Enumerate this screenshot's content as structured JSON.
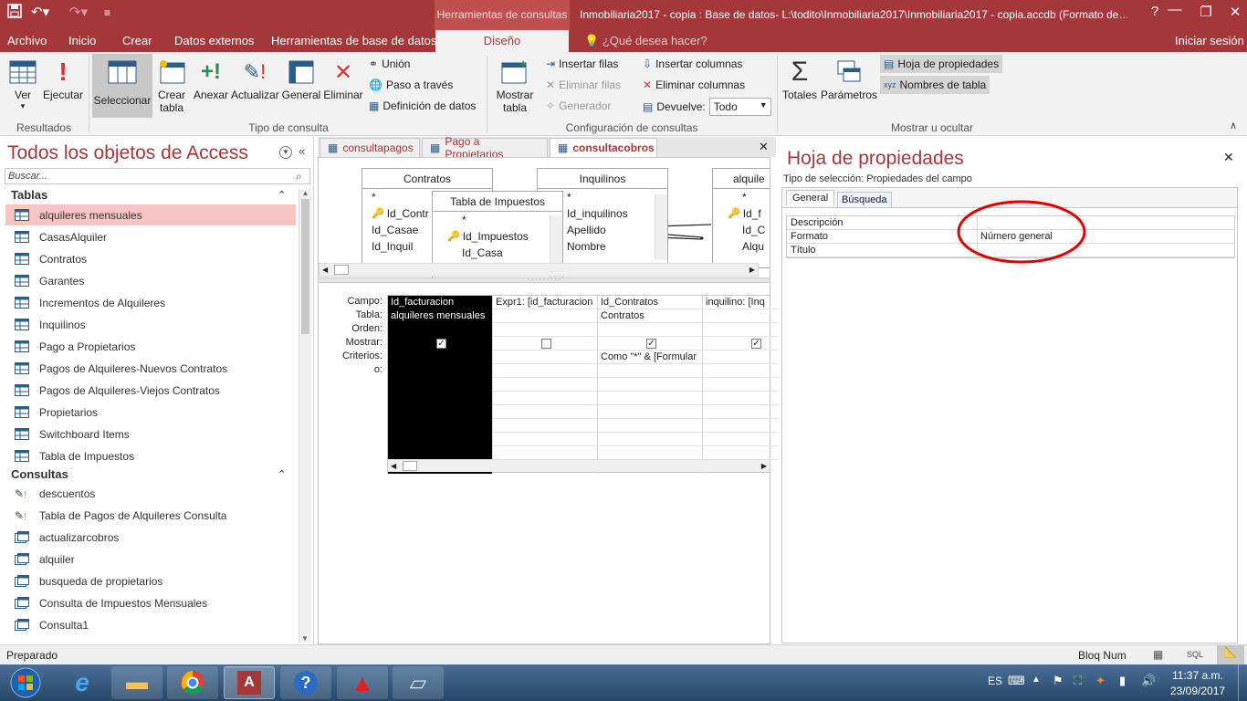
{
  "window": {
    "contextual_tab": "Herramientas de consultas",
    "title": "Inmobiliaria2017 - copia : Base de datos- L:\\todito\\Inmobiliaria2017\\Inmobiliaria2017 - copia.accdb (Formato de…",
    "help": "?",
    "minimize": "—",
    "restore": "❐",
    "close": "✕"
  },
  "menu": {
    "items": [
      "Archivo",
      "Inicio",
      "Crear",
      "Datos externos",
      "Herramientas de base de datos",
      "Diseño"
    ],
    "tell_me": "¿Qué desea hacer?",
    "signin": "Iniciar sesión"
  },
  "ribbon": {
    "ver": "Ver",
    "ejecutar": "Ejecutar",
    "group_resultados": "Resultados",
    "seleccionar": "Seleccionar",
    "crear_tabla_1": "Crear",
    "crear_tabla_2": "tabla",
    "anexar": "Anexar",
    "actualizar": "Actualizar",
    "general": "General",
    "eliminar": "Eliminar",
    "union": "Unión",
    "paso_a_traves": "Paso a través",
    "definicion_datos": "Definición de datos",
    "group_tipo": "Tipo de consulta",
    "mostrar_tabla_1": "Mostrar",
    "mostrar_tabla_2": "tabla",
    "insertar_filas": "Insertar filas",
    "eliminar_filas": "Eliminar filas",
    "generador": "Generador",
    "insertar_columnas": "Insertar columnas",
    "eliminar_columnas": "Eliminar columnas",
    "devuelve": "Devuelve:",
    "devuelve_value": "Todo",
    "group_config": "Configuración de consultas",
    "totales": "Totales",
    "parametros": "Parámetros",
    "hoja_propiedades": "Hoja de propiedades",
    "nombres_tabla": "Nombres de tabla",
    "group_mostrar": "Mostrar u ocultar"
  },
  "nav": {
    "title": "Todos los objetos de Access",
    "search_placeholder": "Buscar...",
    "section_tables": "Tablas",
    "tables": [
      "alquileres mensuales",
      "CasasAlquiler",
      "Contratos",
      "Garantes",
      "Incrementos de Alquileres",
      "Inquilinos",
      "Pago a Propietarios",
      "Pagos de Alquileres-Nuevos Contratos",
      "Pagos de Alquileres-Viejos Contratos",
      "Propietarios",
      "Switchboard Items",
      "Tabla de Impuestos"
    ],
    "section_queries": "Consultas",
    "queries": [
      "descuentos",
      "Tabla de Pagos de Alquileres Consulta",
      "actualizarcobros",
      "alquiler",
      "busqueda de propietarios",
      "Consulta de Impuestos Mensuales",
      "Consulta1"
    ]
  },
  "doc_tabs": [
    "consultapagos",
    "Pago a Propietarios",
    "consultacobros"
  ],
  "query": {
    "tables": {
      "contratos": {
        "title": "Contratos",
        "fields": [
          "*",
          "Id_Contr",
          "Id_Casae",
          "Id_Inquil"
        ]
      },
      "impuestos": {
        "title": "Tabla de Impuestos",
        "fields": [
          "*",
          "Id_Impuestos",
          "Id_Casa"
        ]
      },
      "inquilinos": {
        "title": "Inquilinos",
        "fields": [
          "*",
          "Id_inquilinos",
          "Apellido",
          "Nombre"
        ]
      },
      "alquileres": {
        "title": "alquile",
        "fields": [
          "*",
          "Id_f",
          "Id_C",
          "Alqu"
        ]
      }
    },
    "row_labels": [
      "Campo:",
      "Tabla:",
      "Orden:",
      "Mostrar:",
      "Criterios:",
      "o:"
    ],
    "columns": [
      {
        "campo": "Id_facturacion",
        "tabla": "alquileres mensuales",
        "orden": "",
        "mostrar": true,
        "criterios": ""
      },
      {
        "campo": "Expr1: [id_facturacion",
        "tabla": "",
        "orden": "",
        "mostrar": false,
        "criterios": ""
      },
      {
        "campo": "Id_Contratos",
        "tabla": "Contratos",
        "orden": "",
        "mostrar": true,
        "criterios": "Como \"*\" & [Formular"
      },
      {
        "campo": "inquilino: [Inq",
        "tabla": "",
        "orden": "",
        "mostrar": true,
        "criterios": ""
      }
    ]
  },
  "props": {
    "title": "Hoja de propiedades",
    "selection_type": "Tipo de selección:  Propiedades del campo",
    "tabs": [
      "General",
      "Búsqueda"
    ],
    "rows": [
      {
        "name": "Descripción",
        "value": ""
      },
      {
        "name": "Formato",
        "value": "Número general"
      },
      {
        "name": "Título",
        "value": ""
      }
    ],
    "highlight_color": "#e00000"
  },
  "status": {
    "left": "Preparado",
    "bloq": "Bloq Num",
    "sql": "SQL"
  },
  "taskbar": {
    "lang": "ES",
    "time": "11:37 a.m.",
    "date": "23/09/2017"
  }
}
